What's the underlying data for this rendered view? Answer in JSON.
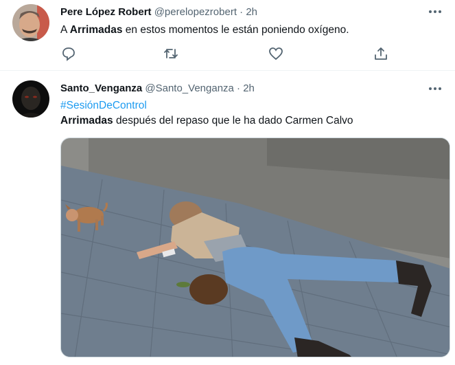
{
  "tweets": [
    {
      "name": "Pere López Robert",
      "handle": "@perelopezrobert",
      "dot": "·",
      "time": "2h",
      "text_prefix": "A ",
      "text_bold": "Arrimadas",
      "text_rest": " en estos momentos le están poniendo oxígeno.",
      "actions": [
        "reply-icon",
        "retweet-icon",
        "like-icon",
        "share-icon"
      ]
    },
    {
      "name": "Santo_Venganza",
      "handle": "@Santo_Venganza",
      "dot": "·",
      "time": "2h",
      "hashtag": "#SesiónDeControl",
      "text_bold": "Arrimadas",
      "text_rest": " después del repaso que le ha dado Carmen Calvo"
    }
  ],
  "colors": {
    "accent": "#1d9bf0",
    "secondary_text": "#536471",
    "divider": "#eff3f4"
  }
}
